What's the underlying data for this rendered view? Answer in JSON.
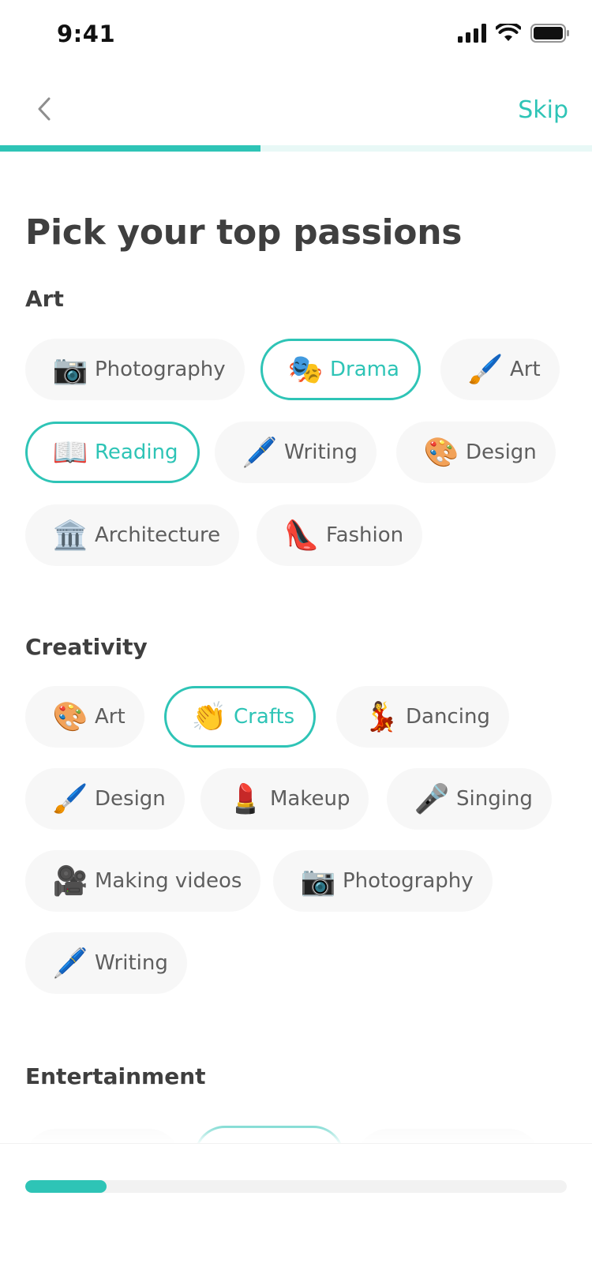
{
  "status_bar": {
    "time": "9:41",
    "icons": [
      "signal-icon",
      "wifi-icon",
      "battery-icon"
    ]
  },
  "nav": {
    "back_icon": "chevron-left-icon",
    "skip_label": "Skip"
  },
  "progress": {
    "top_fraction": 0.44,
    "bottom_fraction": 0.15
  },
  "colors": {
    "accent": "#2ec4b6",
    "chip_bg": "#f7f7f7",
    "text": "#3f3f3f"
  },
  "page": {
    "title": "Pick your top passions"
  },
  "sections": [
    {
      "title": "Art",
      "chips": [
        {
          "emoji": "📷",
          "label": "Photography",
          "selected": false
        },
        {
          "emoji": "🎭",
          "label": "Drama",
          "selected": true
        },
        {
          "emoji": "🖌️",
          "label": "Art",
          "selected": false
        },
        {
          "emoji": "📖",
          "label": "Reading",
          "selected": true
        },
        {
          "emoji": "🖊️",
          "label": "Writing",
          "selected": false
        },
        {
          "emoji": "🎨",
          "label": "Design",
          "selected": false
        },
        {
          "emoji": "🏛️",
          "label": "Architecture",
          "selected": false
        },
        {
          "emoji": "👠",
          "label": "Fashion",
          "selected": false
        }
      ]
    },
    {
      "title": "Creativity",
      "chips": [
        {
          "emoji": "🎨",
          "label": "Art",
          "selected": false
        },
        {
          "emoji": "👏",
          "label": "Crafts",
          "selected": true
        },
        {
          "emoji": "💃",
          "label": "Dancing",
          "selected": false
        },
        {
          "emoji": "🖌️",
          "label": "Design",
          "selected": false
        },
        {
          "emoji": "💄",
          "label": "Makeup",
          "selected": false
        },
        {
          "emoji": "🎤",
          "label": "Singing",
          "selected": false
        },
        {
          "emoji": "🎥",
          "label": "Making videos",
          "selected": false
        },
        {
          "emoji": "📷",
          "label": "Photography",
          "selected": false
        },
        {
          "emoji": "🖊️",
          "label": "Writing",
          "selected": false
        }
      ]
    },
    {
      "title": "Entertainment",
      "chips": []
    }
  ]
}
